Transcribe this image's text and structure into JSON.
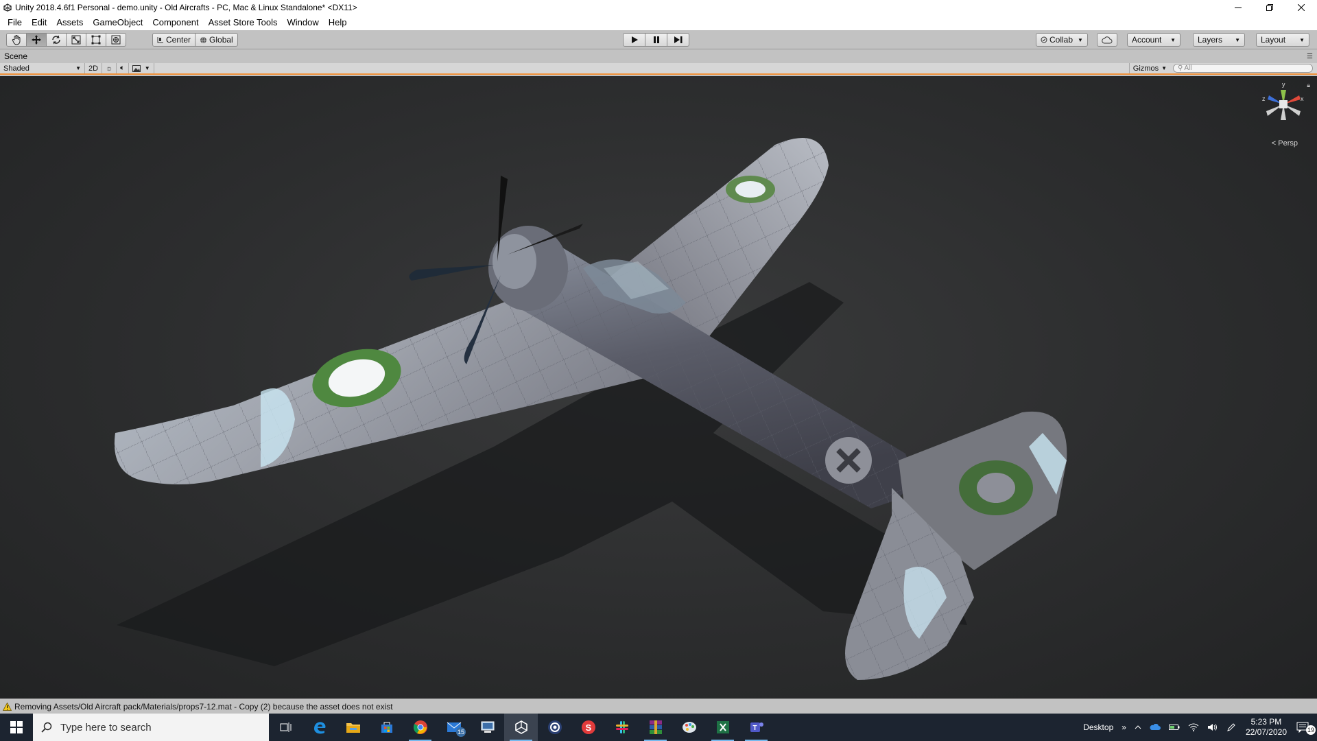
{
  "window": {
    "title": "Unity 2018.4.6f1 Personal - demo.unity - Old Aircrafts - PC, Mac & Linux Standalone* <DX11>",
    "controls": [
      "minimize-icon",
      "restore-icon",
      "close-icon"
    ]
  },
  "menu": {
    "items": [
      "File",
      "Edit",
      "Assets",
      "GameObject",
      "Component",
      "Asset Store Tools",
      "Window",
      "Help"
    ]
  },
  "toolbar": {
    "tools": [
      "hand-tool-icon",
      "move-tool-icon",
      "rotate-tool-icon",
      "scale-tool-icon",
      "rect-tool-icon",
      "transform-tool-icon"
    ],
    "active_tool": "move-tool-icon",
    "pivot_label": "Center",
    "space_label": "Global",
    "collab_label": "Collab",
    "account_label": "Account",
    "layers_label": "Layers",
    "layout_label": "Layout"
  },
  "scene": {
    "tab_label": "Scene",
    "draw_mode": "Shaded",
    "mode_2d": "2D",
    "gizmos_label": "Gizmos",
    "search_placeholder": "All",
    "persp_label": "Persp",
    "axis_labels": {
      "y": "y",
      "x": "x",
      "z": "z"
    }
  },
  "status": {
    "message": "Removing Assets/Old Aircraft pack/Materials/props7-12.mat - Copy (2) because the asset does not exist"
  },
  "taskbar": {
    "search_placeholder": "Type here to search",
    "apps": [
      {
        "icon": "task-view-icon"
      },
      {
        "icon": "edge-icon"
      },
      {
        "icon": "file-explorer-icon"
      },
      {
        "icon": "store-icon"
      },
      {
        "icon": "chrome-icon"
      },
      {
        "icon": "mail-icon",
        "badge": "15"
      },
      {
        "icon": "network-app-icon"
      },
      {
        "icon": "unity-icon"
      },
      {
        "icon": "cinema4d-icon"
      },
      {
        "icon": "substance-icon"
      },
      {
        "icon": "slack-icon"
      },
      {
        "icon": "winrar-icon"
      },
      {
        "icon": "paint-icon"
      },
      {
        "icon": "excel-icon"
      },
      {
        "icon": "teams-icon"
      }
    ],
    "desktop_label": "Desktop",
    "time": "5:23 PM",
    "date": "22/07/2020",
    "notifications": "19"
  },
  "colors": {
    "scene_accent": "#f0913a",
    "taskbar_bg": "#1c2430"
  }
}
